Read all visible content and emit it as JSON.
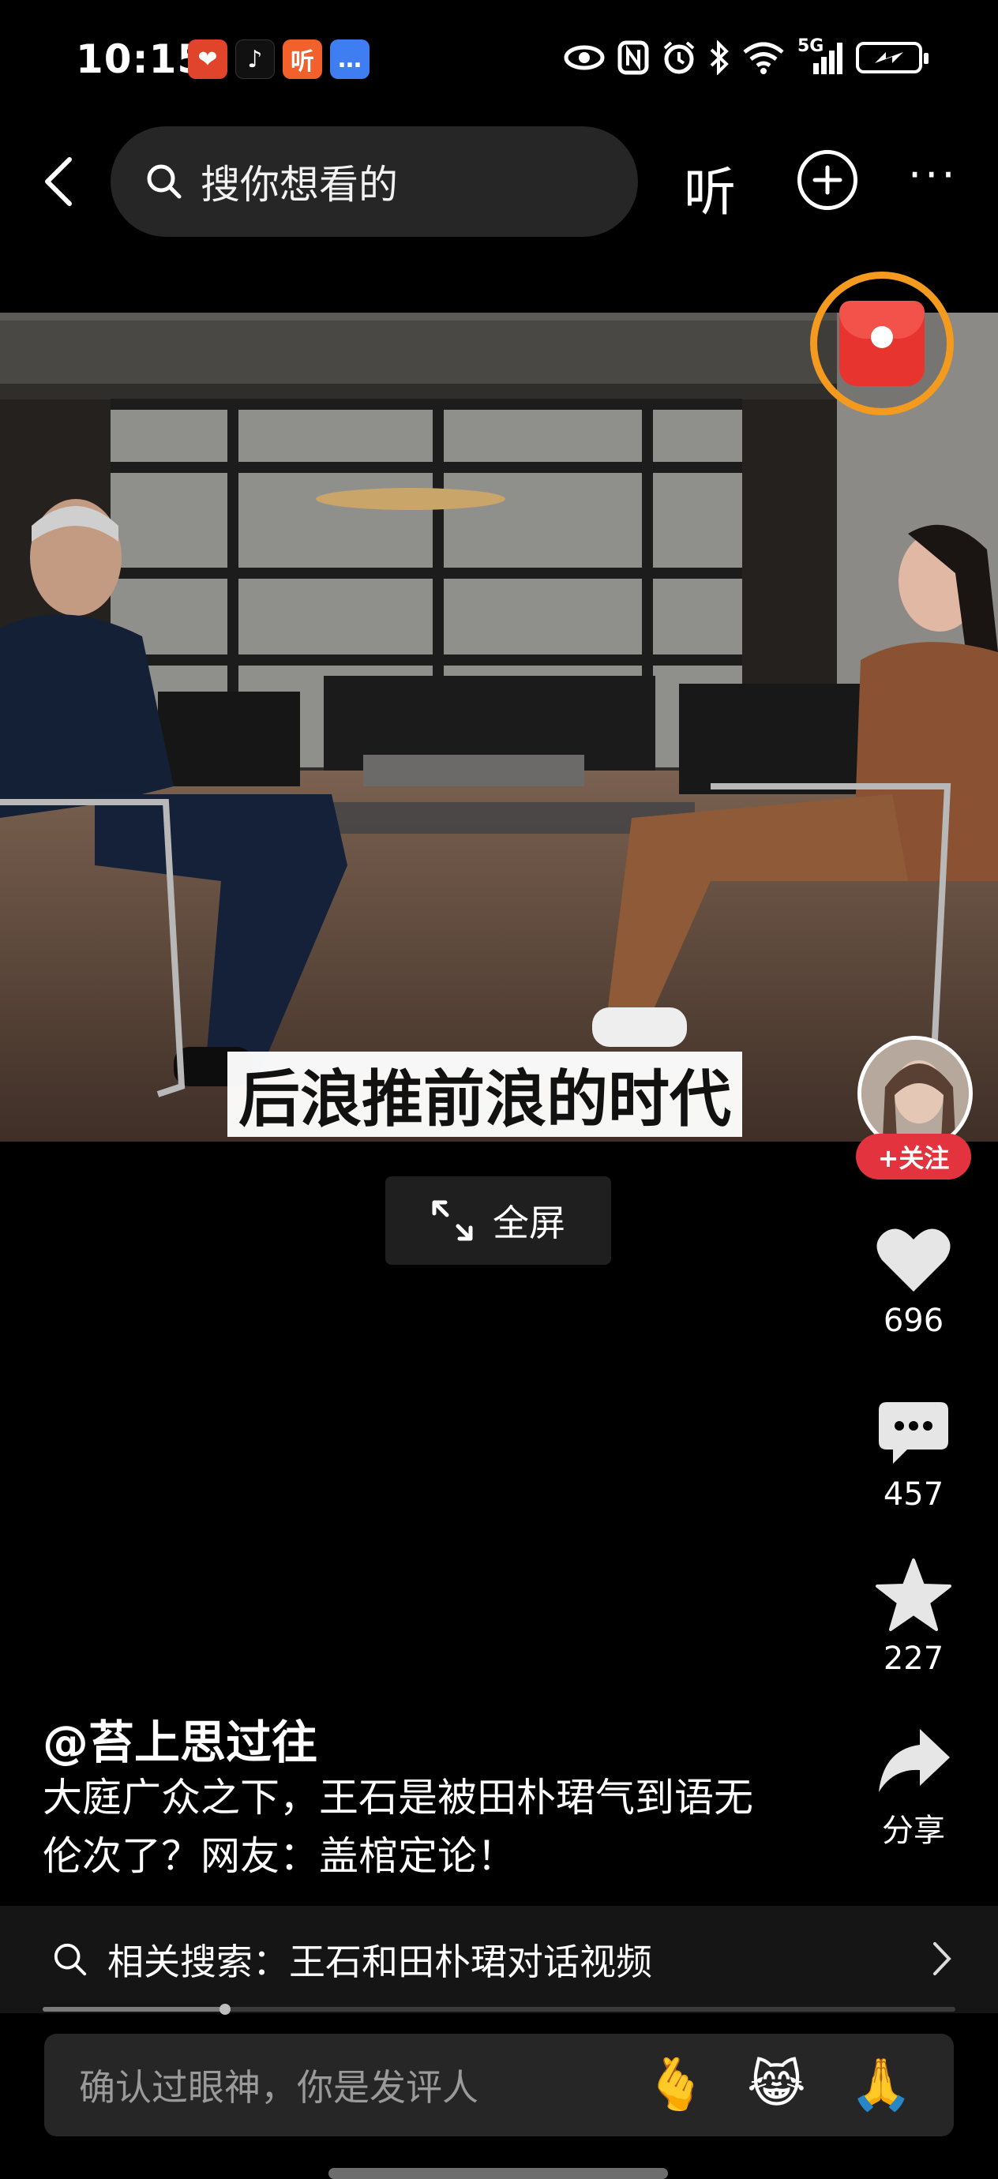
{
  "status_bar": {
    "time": "10:15",
    "notifications": [
      {
        "icon": "pinduoduo-app-icon",
        "glyph": "❤"
      },
      {
        "icon": "tiktok-app-icon",
        "glyph": "♪"
      },
      {
        "icon": "listen-app-icon",
        "glyph": "听"
      },
      {
        "icon": "message-app-icon",
        "glyph": "…"
      }
    ],
    "network_label": "5G"
  },
  "top_bar": {
    "search_placeholder": "搜你想看的",
    "listen_label": "听",
    "more_label": "···"
  },
  "video": {
    "caption": "后浪推前浪的时代",
    "fullscreen_label": "全屏"
  },
  "right_rail": {
    "follow_label": "+关注",
    "like_count": "696",
    "comment_count": "457",
    "favorite_count": "227",
    "share_label": "分享"
  },
  "post": {
    "author": "@苔上思过往",
    "description": "大庭广众之下，王石是被田朴珺气到语无伦次了？网友：盖棺定论！"
  },
  "related_search": {
    "text": "相关搜索：王石和田朴珺对话视频"
  },
  "playback": {
    "progress_fraction": 0.2
  },
  "comment_bar": {
    "placeholder": "确认过眼神，你是发评人",
    "emojis": [
      "🫰",
      "😹",
      "🙏"
    ]
  },
  "colors": {
    "accent_red": "#e3333f",
    "redpacket_ring": "#f49a1e"
  }
}
